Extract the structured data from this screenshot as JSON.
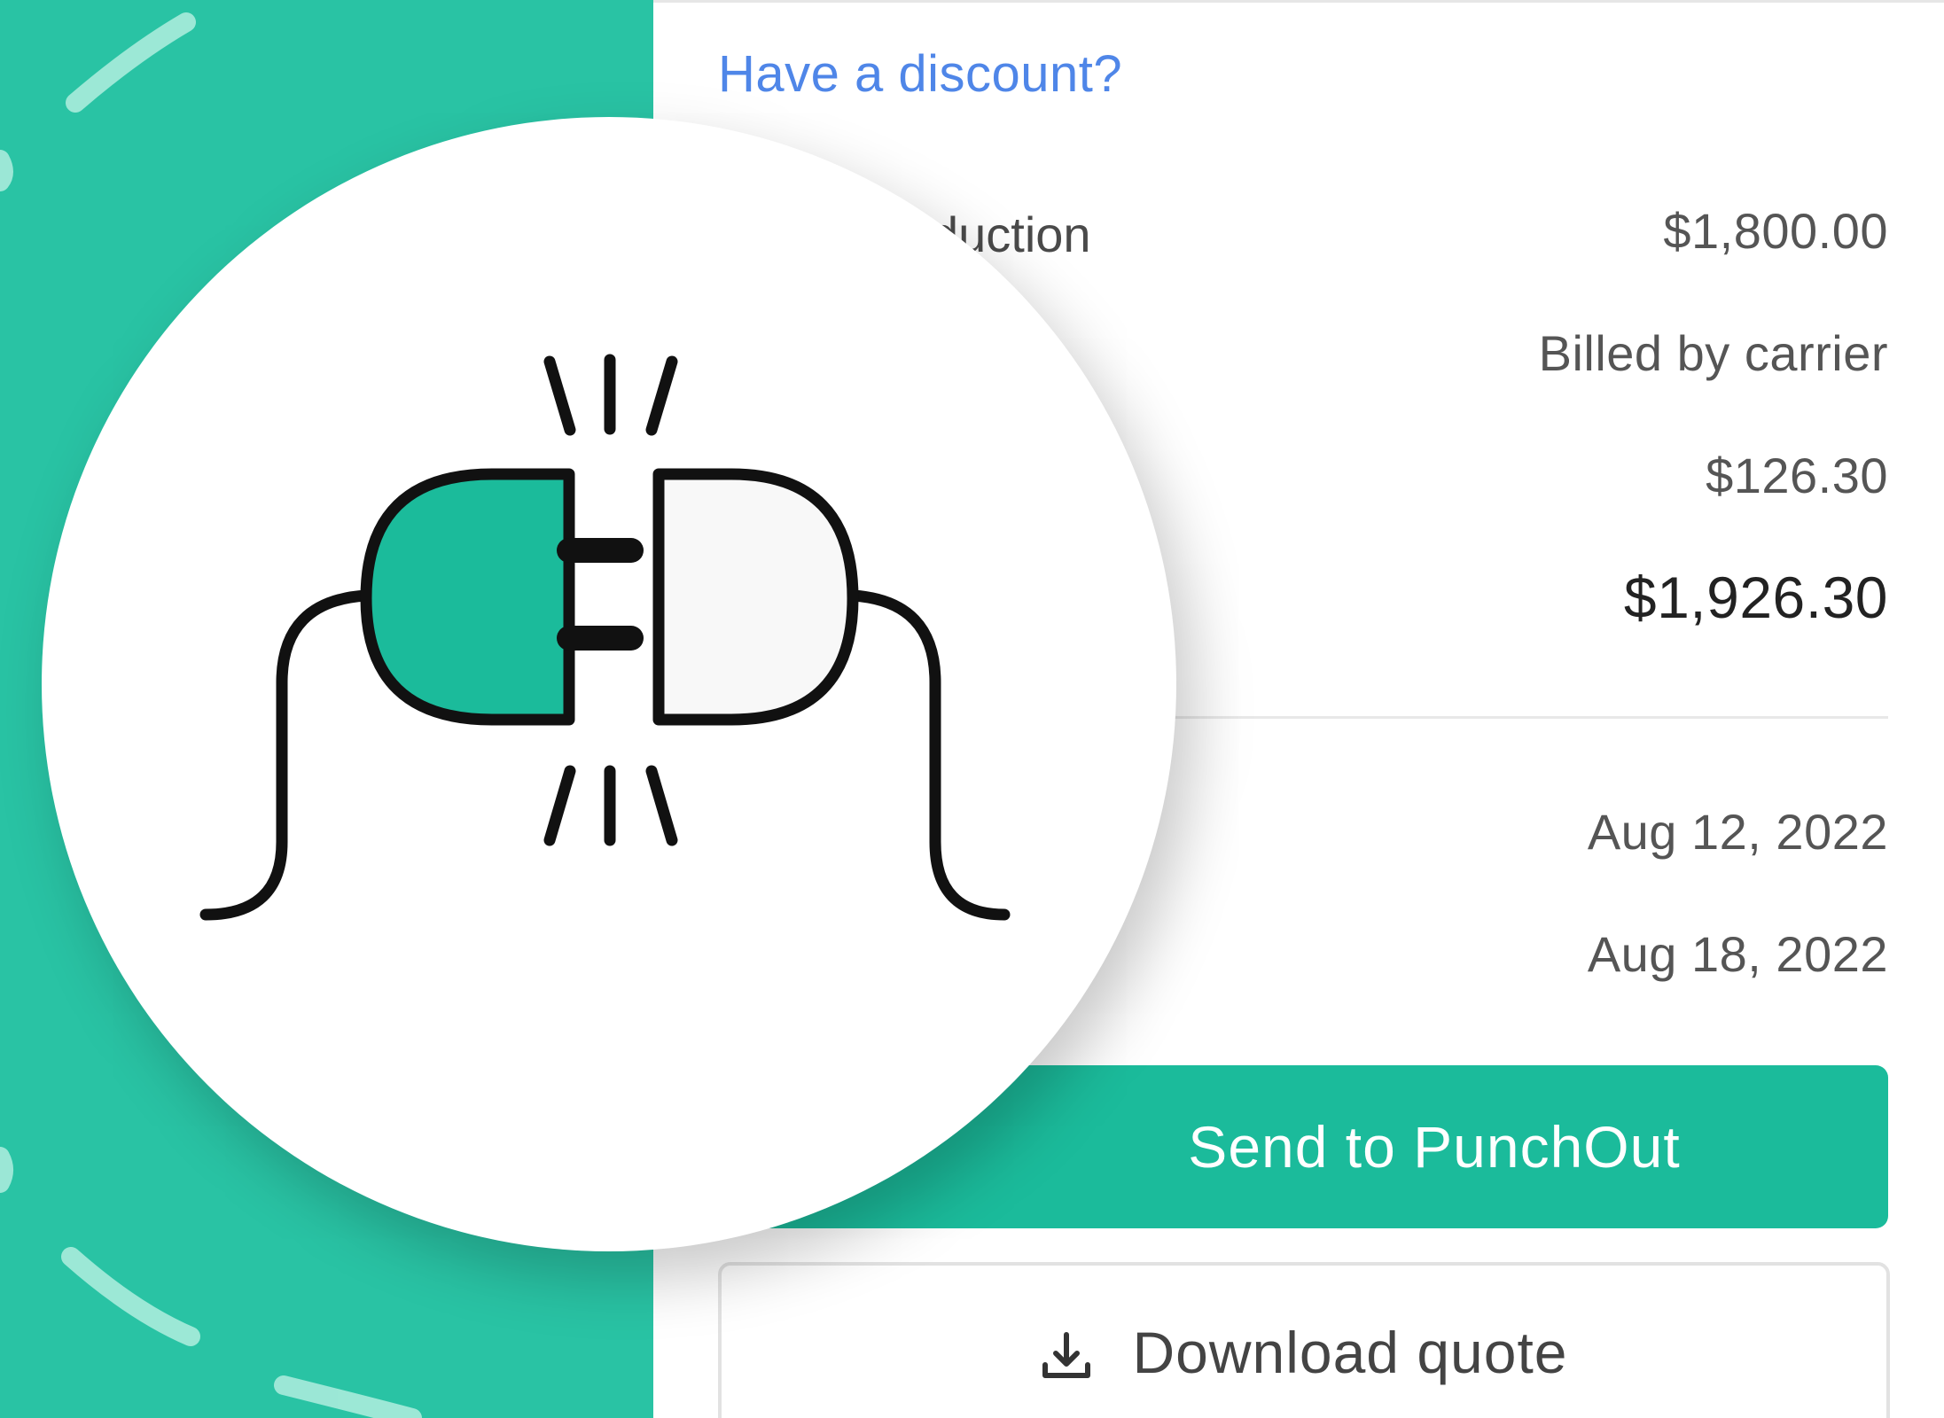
{
  "quote": {
    "discount_link": "Have a discount?",
    "rows": [
      {
        "label": "duction",
        "value": "$1,800.00"
      },
      {
        "label": "",
        "value": "Billed by carrier"
      },
      {
        "label": "",
        "value": "$126.30"
      },
      {
        "label": "",
        "value": "$1,926.30"
      },
      {
        "label": "",
        "value": "Aug 12, 2022"
      },
      {
        "label": "",
        "value": "Aug 18, 2022"
      }
    ],
    "punchout_button": "Send to PunchOut",
    "download_button": "Download quote"
  },
  "illustration": {
    "icon": "unplugged-plugs-icon",
    "accent_color": "#1bbb9b",
    "panel_color": "#29c3a4"
  },
  "icons": {
    "download": "download-icon"
  }
}
